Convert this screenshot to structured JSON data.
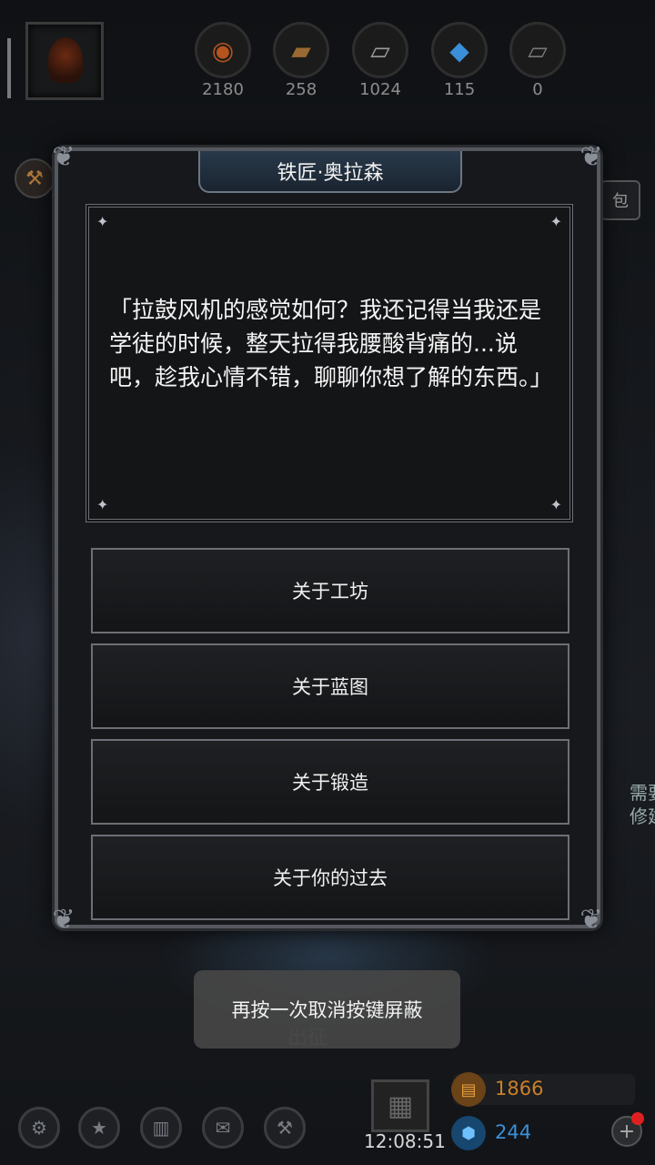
{
  "resources": [
    {
      "icon": "copper-ore-icon",
      "value": "2180"
    },
    {
      "icon": "wood-planks-icon",
      "value": "258"
    },
    {
      "icon": "iron-ingot-icon",
      "value": "1024"
    },
    {
      "icon": "blue-crystal-icon",
      "value": "115"
    },
    {
      "icon": "steel-ingot-icon",
      "value": "0"
    }
  ],
  "side": {
    "bag_label": "包",
    "note": "需要修建"
  },
  "dialog": {
    "npc_name": "铁匠·奥拉森",
    "speech": "「拉鼓风机的感觉如何？我还记得当我还是学徒的时候，整天拉得我腰酸背痛的...说吧，趁我心情不错，聊聊你想了解的东西。」",
    "options": [
      "关于工坊",
      "关于蓝图",
      "关于锻造",
      "关于你的过去"
    ]
  },
  "toast": "再按一次取消按键屏蔽",
  "background_label": "出征",
  "bottom": {
    "clock": "12:08:51",
    "gold": "1866",
    "gems": "244"
  },
  "colors": {
    "gold": "#c9812a",
    "gem": "#3a8fd8",
    "notify": "#e02020"
  }
}
